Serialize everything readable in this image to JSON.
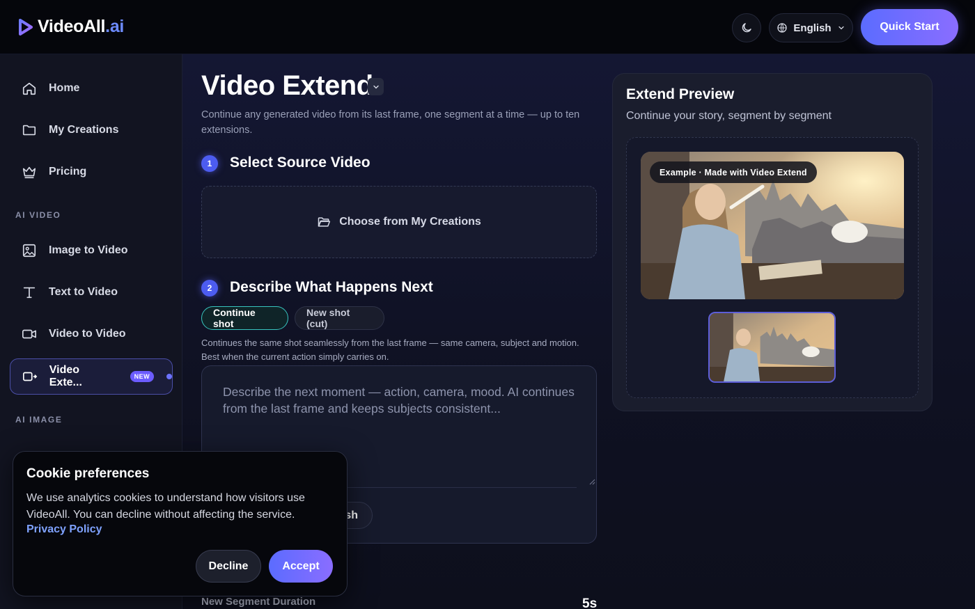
{
  "brand": {
    "name": "VideoAll",
    "suffix": ".ai"
  },
  "header": {
    "language": "English",
    "quick_start": "Quick Start"
  },
  "sidebar": {
    "items": [
      {
        "label": "Home",
        "icon": "home-icon"
      },
      {
        "label": "My Creations",
        "icon": "folder-icon"
      },
      {
        "label": "Pricing",
        "icon": "crown-icon"
      }
    ],
    "section_ai_video": "AI VIDEO",
    "video_items": [
      {
        "label": "Image to Video",
        "icon": "image-icon"
      },
      {
        "label": "Text to Video",
        "icon": "text-icon"
      },
      {
        "label": "Video to Video",
        "icon": "video-icon"
      },
      {
        "label": "Video Exte...",
        "icon": "video-extend-icon",
        "badge": "NEW",
        "active": true
      }
    ],
    "section_ai_image": "AI IMAGE"
  },
  "main": {
    "title": "Video Extend",
    "subtitle": "Continue any generated video from its last frame, one segment at a time — up to ten extensions.",
    "step1": {
      "num": "1",
      "title": "Select Source Video",
      "choose_label": "Choose from My Creations"
    },
    "step2": {
      "num": "2",
      "title": "Describe What Happens Next",
      "mode_continue": "Continue shot",
      "mode_cut": "New shot (cut)",
      "hint": "Continues the same shot seamlessly from the last frame — same camera, subject and motion. Best when the current action simply carries on.",
      "placeholder": "Describe the next moment — action, camera, mood. AI continues from the last frame and keeps subjects consistent...",
      "polish_partial": "sh"
    },
    "duration_label": "New Segment Duration",
    "duration_value": "5s"
  },
  "preview": {
    "title": "Extend Preview",
    "subtitle": "Continue your story, segment by segment",
    "example_tag": "Example · Made with Video Extend"
  },
  "cookie": {
    "title": "Cookie preferences",
    "text": "We use analytics cookies to understand how visitors use VideoAll. You can decline without affecting the service.",
    "link": "Privacy Policy",
    "decline": "Decline",
    "accept": "Accept"
  },
  "colors": {
    "accent": "#5b6cff",
    "accent2": "#8a6dff",
    "teal": "#38c6c0",
    "link": "#7fa2ff"
  }
}
